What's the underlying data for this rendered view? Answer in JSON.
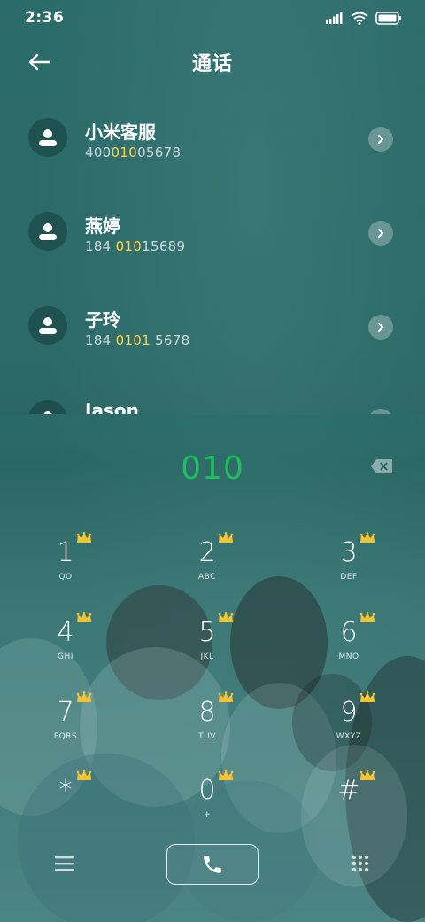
{
  "status": {
    "time": "2:36"
  },
  "header": {
    "title": "通话"
  },
  "contacts": [
    {
      "name": "小米客服",
      "number_parts": [
        "400",
        "010",
        "05678"
      ]
    },
    {
      "name": "燕婷",
      "number_parts": [
        "184 ",
        "010",
        "15689"
      ]
    },
    {
      "name": "子玲",
      "number_parts": [
        "184 ",
        "0101",
        " 5678"
      ]
    },
    {
      "name": "Jason",
      "number_parts": [
        "",
        "",
        ""
      ]
    }
  ],
  "dialer": {
    "input": "010",
    "keys": [
      {
        "digit": "1",
        "letters": "QO"
      },
      {
        "digit": "2",
        "letters": "ABC"
      },
      {
        "digit": "3",
        "letters": "DEF"
      },
      {
        "digit": "4",
        "letters": "GHI"
      },
      {
        "digit": "5",
        "letters": "JKL"
      },
      {
        "digit": "6",
        "letters": "MNO"
      },
      {
        "digit": "7",
        "letters": "PQRS"
      },
      {
        "digit": "8",
        "letters": "TUV"
      },
      {
        "digit": "9",
        "letters": "WXYZ"
      },
      {
        "digit": "*",
        "letters": ""
      },
      {
        "digit": "0",
        "letters": "+"
      },
      {
        "digit": "#",
        "letters": ""
      }
    ]
  },
  "colors": {
    "dial_input": "#1fbf5a",
    "highlight": "#ffd54a",
    "crown": "#f4c430"
  },
  "icons": {
    "back": "arrow-left-icon",
    "avatar": "person-icon",
    "detail": "chevron-right-icon",
    "delete": "backspace-icon",
    "menu": "hamburger-icon",
    "call": "phone-icon",
    "keypad": "dialpad-icon"
  }
}
